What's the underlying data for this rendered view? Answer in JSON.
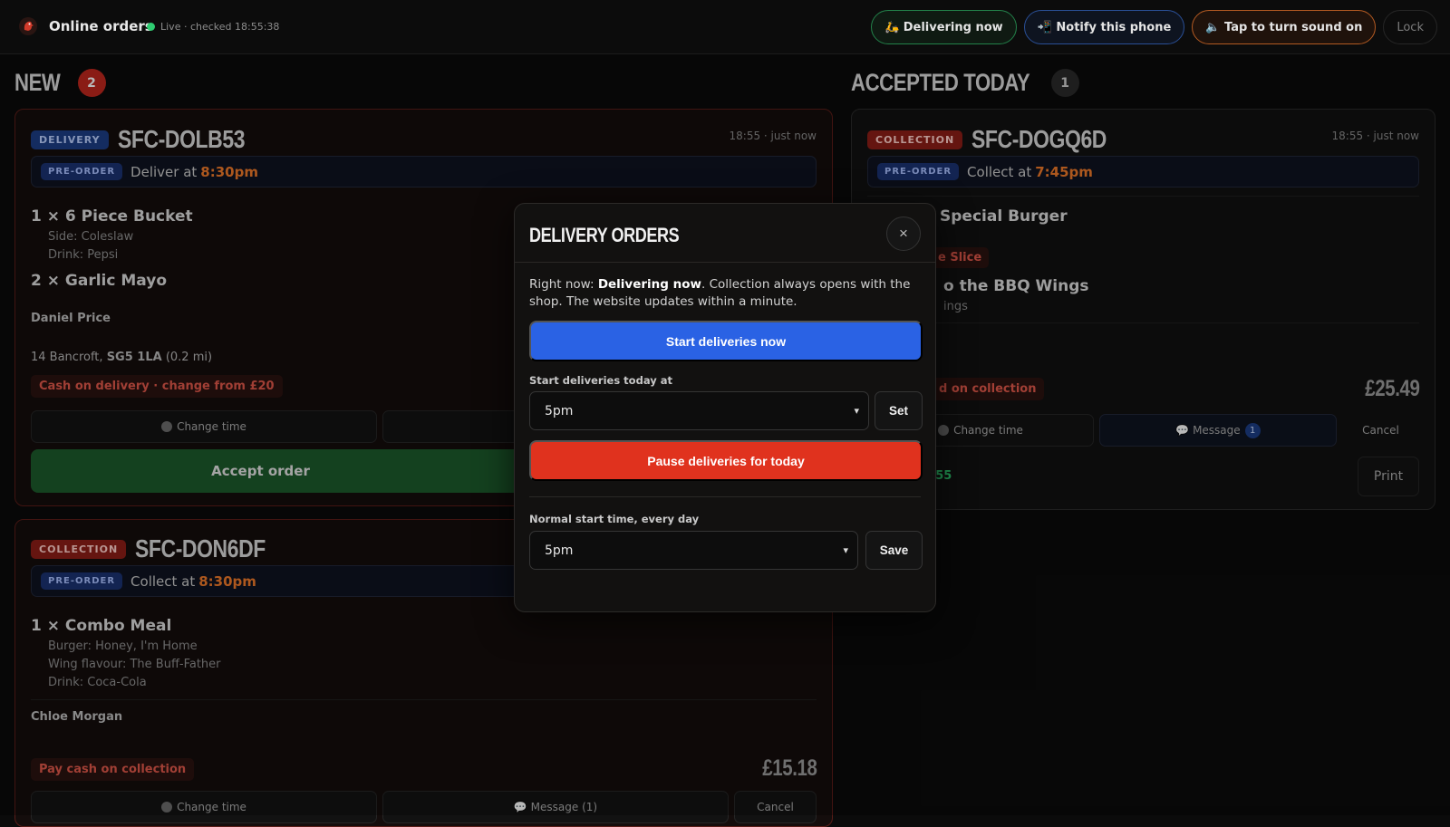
{
  "header": {
    "app_title": "Online orders",
    "live_status": "Live · checked 18:55:38",
    "delivering_label": "🛵 Delivering now",
    "notify_label": "📲 Notify this phone",
    "sound_label": "🔈 Tap to turn sound on",
    "lock_label": "Lock",
    "colors": {
      "live": "#2ecc71",
      "accent": "#f07a2a"
    }
  },
  "new_section": {
    "title": "NEW",
    "count": "2",
    "orders": [
      {
        "type": "DELIVERY",
        "id": "SFC-DOLB53",
        "time": "18:55 · just now",
        "pre_badge": "PRE-ORDER",
        "pre_text": "Deliver at",
        "pre_time": "8:30pm",
        "items": [
          {
            "line": "1 × 6 Piece Bucket",
            "options": [
              "Side: Coleslaw",
              "Drink: Pepsi"
            ]
          },
          {
            "line": "2 × Garlic Mayo",
            "options": []
          }
        ],
        "customer": "Daniel Price",
        "address_prefix": "14 Bancroft,",
        "address_postcode": "SG5 1LA",
        "address_distance": "(0.2 mi)",
        "payment": "Cash on delivery · change from £20",
        "change_time": "Change time",
        "accept": "Accept order"
      },
      {
        "type": "COLLECTION",
        "id": "SFC-DON6DF",
        "pre_badge": "PRE-ORDER",
        "pre_text": "Collect at",
        "pre_time": "8:30pm",
        "items": [
          {
            "line": "1 × Combo Meal",
            "options": [
              "Burger: Honey, I'm Home",
              "Wing flavour: The Buff-Father",
              "Drink: Coca-Cola"
            ]
          }
        ],
        "customer": "Chloe Morgan",
        "payment": "Pay cash on collection",
        "price": "£15.18",
        "change_time": "Change time",
        "message": "💬 Message (1)",
        "cancel": "Cancel"
      }
    ]
  },
  "accepted_section": {
    "title": "ACCEPTED TODAY",
    "count": "1",
    "order": {
      "type": "COLLECTION",
      "id": "SFC-DOGQ6D",
      "time": "18:55 · just now",
      "pre_badge": "PRE-ORDER",
      "pre_text": "Collect at",
      "pre_time": "7:45pm",
      "item_1": "Special Burger",
      "tag": "e Slice",
      "item_2": "o the BBQ Wings",
      "opt_2": "ings",
      "payment": "d on collection",
      "price": "£25.49",
      "change_time": "Change time",
      "message": "💬 Message",
      "message_count": "1",
      "cancel": "Cancel",
      "accepted_time": ":55",
      "print": "Print"
    }
  },
  "modal": {
    "title": "DELIVERY ORDERS",
    "close_icon": "×",
    "info_prefix": "Right now: ",
    "info_bold": "Delivering now",
    "info_suffix": ". Collection always opens with the shop. The website updates within a minute.",
    "start_now": "Start deliveries now",
    "start_today_label": "Start deliveries today at",
    "start_today_value": "5pm",
    "set": "Set",
    "pause": "Pause deliveries for today",
    "normal_label": "Normal start time, every day",
    "normal_value": "5pm",
    "save": "Save",
    "colors": {
      "primary": "#2a62e4",
      "danger": "#e0321e"
    }
  }
}
